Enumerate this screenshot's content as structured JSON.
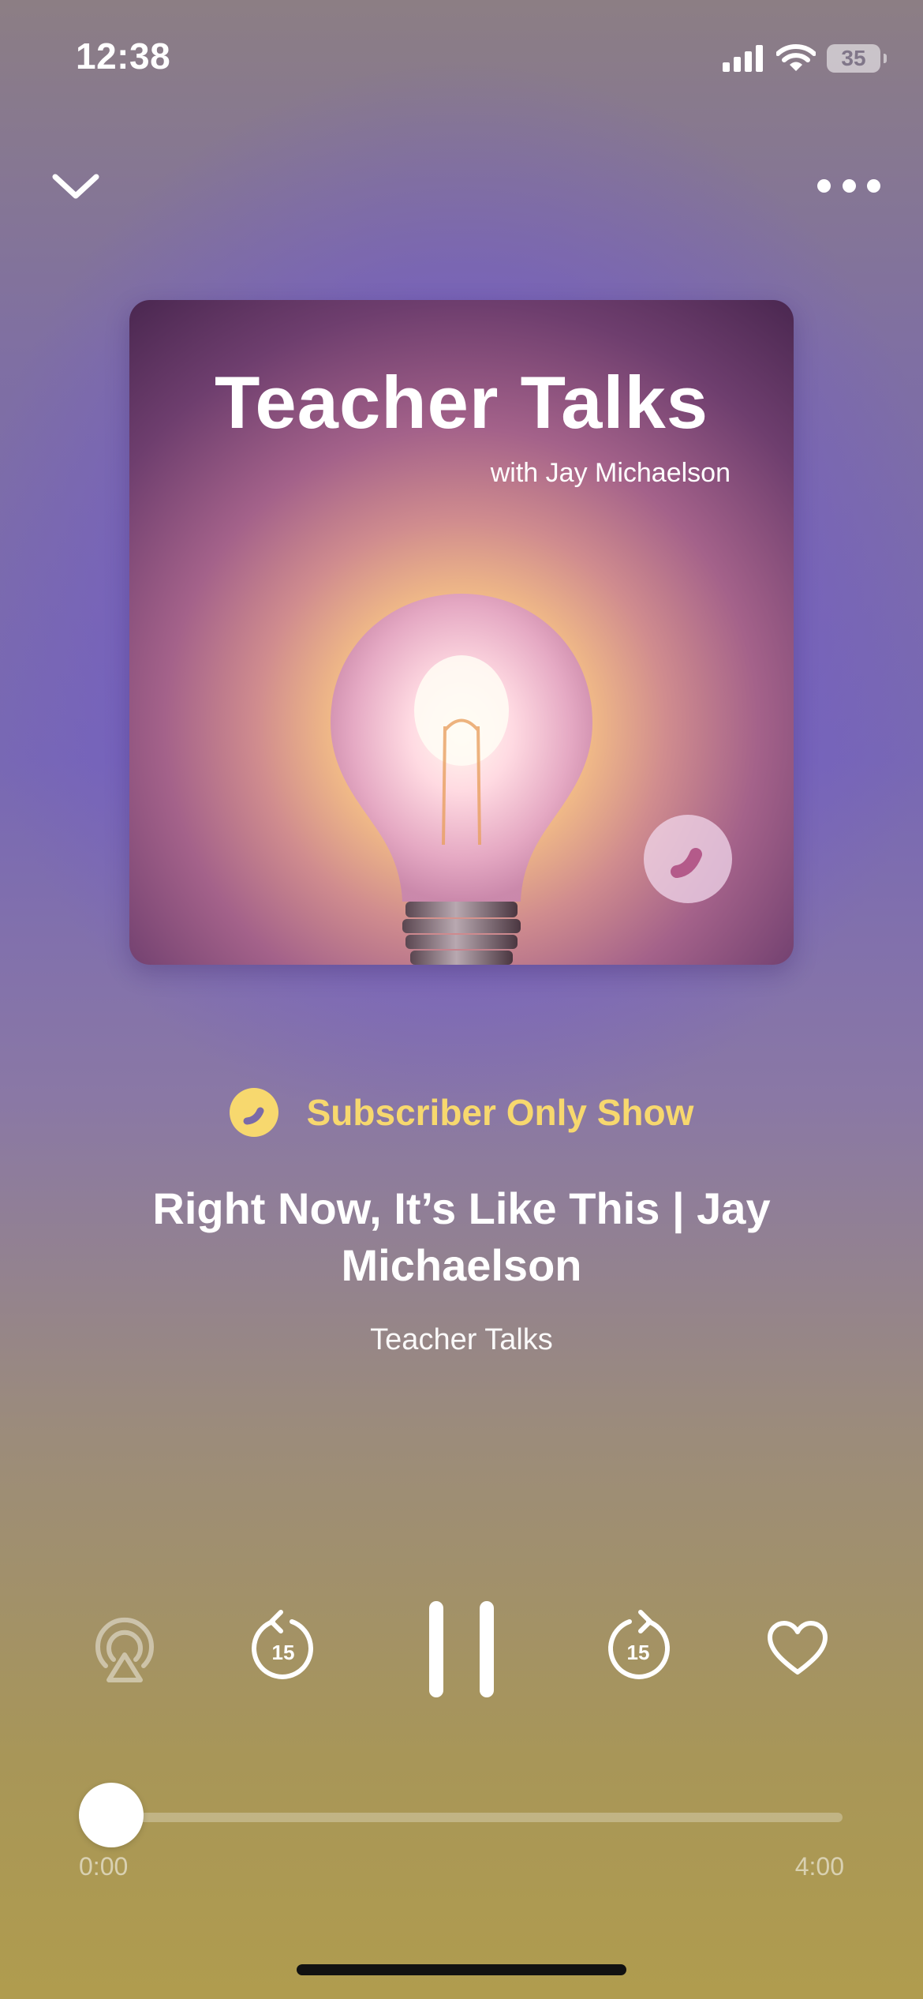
{
  "status_bar": {
    "time": "12:38",
    "battery_level": "35",
    "icons": [
      "cellular-signal-icon",
      "wifi-icon",
      "battery-icon"
    ]
  },
  "header": {
    "collapse_icon": "chevron-down-icon",
    "more_icon": "ellipsis-icon"
  },
  "artwork": {
    "title": "Teacher Talks",
    "subtitle": "with Jay Michaelson",
    "badge_icon": "brand-badge-icon"
  },
  "subscriber": {
    "label": "Subscriber Only Show",
    "icon": "brand-badge-icon",
    "color": "#f7d86e"
  },
  "episode": {
    "title": "Right Now, It’s Like This | Jay Michaelson",
    "show": "Teacher Talks"
  },
  "controls": {
    "airplay_icon": "airplay-icon",
    "rewind_icon": "rewind-15-icon",
    "rewind_seconds": "15",
    "play_state": "playing",
    "pause_icon": "pause-icon",
    "forward_icon": "forward-15-icon",
    "forward_seconds": "15",
    "like_icon": "heart-icon"
  },
  "progress": {
    "elapsed": "0:00",
    "total": "4:00",
    "fraction": 0
  },
  "colors": {
    "accent": "#f7d86e",
    "background_top": "#8c7e84",
    "background_mid": "#7868b4",
    "background_bottom": "#b09c4e"
  }
}
